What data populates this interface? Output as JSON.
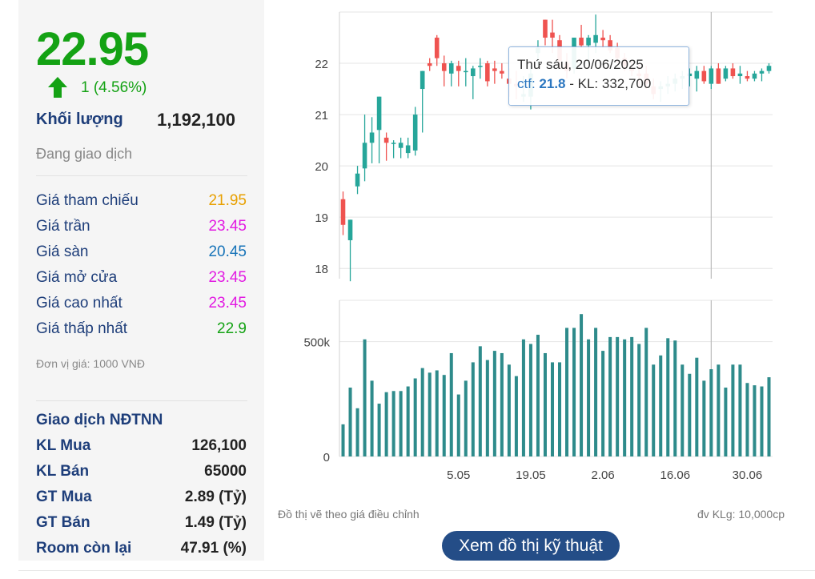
{
  "summary": {
    "price": "22.95",
    "change": "1 (4.56%)",
    "volume_label": "Khối lượng",
    "volume": "1,192,100",
    "status": "Đang giao dịch"
  },
  "price_rows": [
    {
      "label": "Giá tham chiếu",
      "value": "21.95",
      "color": "#e8a000"
    },
    {
      "label": "Giá trần",
      "value": "23.45",
      "color": "#e21be2"
    },
    {
      "label": "Giá sàn",
      "value": "20.45",
      "color": "#1673b8"
    },
    {
      "label": "Giá mở cửa",
      "value": "23.45",
      "color": "#e21be2"
    },
    {
      "label": "Giá cao nhất",
      "value": "23.45",
      "color": "#e21be2"
    },
    {
      "label": "Giá thấp nhất",
      "value": "22.9",
      "color": "#14a214"
    }
  ],
  "unit_note": "Đơn vị giá: 1000 VNĐ",
  "foreign": {
    "title": "Giao dịch NĐTNN",
    "rows": [
      {
        "label": "KL Mua",
        "value": "126,100"
      },
      {
        "label": "KL Bán",
        "value": "65000"
      },
      {
        "label": "GT Mua",
        "value": "2.89 (Tỷ)"
      },
      {
        "label": "GT Bán",
        "value": "1.49 (Tỷ)"
      },
      {
        "label": "Room còn lại",
        "value": "47.91 (%)"
      }
    ]
  },
  "colors": {
    "up": "#26a69a",
    "down": "#ef5350",
    "accent_green": "#14a214",
    "button": "#244d87"
  },
  "chart_data": {
    "type": "candlestick",
    "price_axis": {
      "ticks": [
        "18",
        "19",
        "20",
        "21",
        "22"
      ],
      "ylim": [
        17.8,
        23
      ]
    },
    "volume_axis": {
      "ticks": [
        "0",
        "500k"
      ],
      "ylim": [
        0,
        680000
      ]
    },
    "x_tick_labels": [
      "5.05",
      "19.05",
      "2.06",
      "16.06",
      "30.06"
    ],
    "x_tick_index": [
      16,
      26,
      36,
      46,
      56
    ],
    "grid": true,
    "candles": [
      {
        "o": 19.35,
        "h": 19.5,
        "l": 18.65,
        "c": 18.85,
        "v": 140000
      },
      {
        "o": 18.55,
        "h": 18.95,
        "l": 17.75,
        "c": 18.95,
        "v": 300000
      },
      {
        "o": 19.6,
        "h": 20.0,
        "l": 19.45,
        "c": 19.85,
        "v": 210000
      },
      {
        "o": 19.95,
        "h": 21.0,
        "l": 19.7,
        "c": 20.45,
        "v": 510000
      },
      {
        "o": 20.45,
        "h": 20.95,
        "l": 20.05,
        "c": 20.65,
        "v": 330000
      },
      {
        "o": 20.7,
        "h": 21.35,
        "l": 20.05,
        "c": 21.35,
        "v": 230000
      },
      {
        "o": 20.55,
        "h": 20.65,
        "l": 20.1,
        "c": 20.45,
        "v": 280000
      },
      {
        "o": 20.45,
        "h": 20.5,
        "l": 20.15,
        "c": 20.45,
        "v": 285000
      },
      {
        "o": 20.35,
        "h": 20.55,
        "l": 20.15,
        "c": 20.45,
        "v": 285000
      },
      {
        "o": 20.25,
        "h": 20.55,
        "l": 20.15,
        "c": 20.4,
        "v": 305000
      },
      {
        "o": 20.3,
        "h": 21.15,
        "l": 20.2,
        "c": 21.0,
        "v": 340000
      },
      {
        "o": 21.5,
        "h": 21.85,
        "l": 20.65,
        "c": 21.85,
        "v": 385000
      },
      {
        "o": 22.0,
        "h": 22.1,
        "l": 21.85,
        "c": 21.95,
        "v": 365000
      },
      {
        "o": 22.5,
        "h": 22.55,
        "l": 21.95,
        "c": 22.1,
        "v": 375000
      },
      {
        "o": 22.0,
        "h": 22.15,
        "l": 21.55,
        "c": 21.85,
        "v": 355000
      },
      {
        "o": 21.8,
        "h": 22.05,
        "l": 21.55,
        "c": 22.0,
        "v": 450000
      },
      {
        "o": 21.95,
        "h": 22.05,
        "l": 21.55,
        "c": 21.85,
        "v": 270000
      },
      {
        "o": 21.85,
        "h": 22.1,
        "l": 21.55,
        "c": 21.85,
        "v": 330000
      },
      {
        "o": 21.75,
        "h": 21.95,
        "l": 21.3,
        "c": 21.9,
        "v": 410000
      },
      {
        "o": 21.95,
        "h": 22.1,
        "l": 21.7,
        "c": 21.95,
        "v": 480000
      },
      {
        "o": 22.0,
        "h": 22.05,
        "l": 21.55,
        "c": 21.65,
        "v": 420000
      },
      {
        "o": 21.9,
        "h": 22.05,
        "l": 21.6,
        "c": 21.85,
        "v": 460000
      },
      {
        "o": 21.85,
        "h": 22.0,
        "l": 21.7,
        "c": 21.8,
        "v": 450000
      },
      {
        "o": 21.7,
        "h": 21.9,
        "l": 21.35,
        "c": 21.6,
        "v": 400000
      },
      {
        "o": 21.6,
        "h": 21.85,
        "l": 21.3,
        "c": 21.55,
        "v": 350000
      },
      {
        "o": 21.35,
        "h": 21.75,
        "l": 21.25,
        "c": 21.4,
        "v": 510000
      },
      {
        "o": 21.35,
        "h": 21.95,
        "l": 21.1,
        "c": 21.8,
        "v": 490000
      },
      {
        "o": 22.2,
        "h": 22.45,
        "l": 21.95,
        "c": 22.3,
        "v": 530000
      },
      {
        "o": 22.85,
        "h": 22.85,
        "l": 22.35,
        "c": 22.5,
        "v": 450000
      },
      {
        "o": 22.6,
        "h": 22.85,
        "l": 22.2,
        "c": 22.5,
        "v": 410000
      },
      {
        "o": 22.45,
        "h": 22.55,
        "l": 21.9,
        "c": 22.05,
        "v": 410000
      },
      {
        "o": 22.0,
        "h": 22.2,
        "l": 21.7,
        "c": 21.85,
        "v": 560000
      },
      {
        "o": 21.9,
        "h": 22.5,
        "l": 21.8,
        "c": 22.5,
        "v": 560000
      },
      {
        "o": 22.5,
        "h": 22.75,
        "l": 22.3,
        "c": 22.35,
        "v": 620000
      },
      {
        "o": 22.35,
        "h": 22.55,
        "l": 22.0,
        "c": 22.5,
        "v": 510000
      },
      {
        "o": 22.4,
        "h": 22.95,
        "l": 22.2,
        "c": 22.55,
        "v": 560000
      },
      {
        "o": 22.5,
        "h": 22.65,
        "l": 22.3,
        "c": 22.45,
        "v": 460000
      },
      {
        "o": 22.45,
        "h": 22.55,
        "l": 22.2,
        "c": 22.25,
        "v": 520000
      },
      {
        "o": 22.3,
        "h": 22.4,
        "l": 22.0,
        "c": 22.1,
        "v": 520000
      },
      {
        "o": 22.1,
        "h": 22.2,
        "l": 21.85,
        "c": 21.95,
        "v": 510000
      },
      {
        "o": 21.9,
        "h": 22.05,
        "l": 21.75,
        "c": 21.85,
        "v": 520000
      },
      {
        "o": 21.8,
        "h": 22.0,
        "l": 21.55,
        "c": 21.75,
        "v": 490000
      },
      {
        "o": 21.8,
        "h": 21.95,
        "l": 21.5,
        "c": 21.6,
        "v": 560000
      },
      {
        "o": 21.55,
        "h": 21.7,
        "l": 21.3,
        "c": 21.4,
        "v": 400000
      },
      {
        "o": 21.5,
        "h": 21.65,
        "l": 21.25,
        "c": 21.55,
        "v": 440000
      },
      {
        "o": 21.55,
        "h": 21.75,
        "l": 21.4,
        "c": 21.6,
        "v": 515000
      },
      {
        "o": 21.6,
        "h": 21.8,
        "l": 21.45,
        "c": 21.7,
        "v": 505000
      },
      {
        "o": 21.7,
        "h": 21.85,
        "l": 21.5,
        "c": 21.75,
        "v": 400000
      },
      {
        "o": 21.75,
        "h": 21.9,
        "l": 21.55,
        "c": 21.8,
        "v": 360000
      },
      {
        "o": 21.7,
        "h": 21.95,
        "l": 21.45,
        "c": 21.85,
        "v": 430000
      },
      {
        "o": 21.85,
        "h": 21.95,
        "l": 21.6,
        "c": 21.65,
        "v": 330000
      },
      {
        "o": 21.6,
        "h": 21.95,
        "l": 21.5,
        "c": 21.9,
        "v": 380000
      },
      {
        "o": 21.9,
        "h": 22.0,
        "l": 21.6,
        "c": 21.6,
        "v": 400000
      },
      {
        "o": 21.7,
        "h": 21.95,
        "l": 21.65,
        "c": 21.9,
        "v": 300000
      },
      {
        "o": 21.9,
        "h": 22.0,
        "l": 21.7,
        "c": 21.75,
        "v": 400000
      },
      {
        "o": 21.75,
        "h": 21.95,
        "l": 21.6,
        "c": 21.8,
        "v": 400000
      },
      {
        "o": 21.75,
        "h": 21.85,
        "l": 21.65,
        "c": 21.7,
        "v": 320000
      },
      {
        "o": 21.7,
        "h": 21.85,
        "l": 21.65,
        "c": 21.8,
        "v": 310000
      },
      {
        "o": 21.8,
        "h": 21.9,
        "l": 21.65,
        "c": 21.85,
        "v": 305000
      },
      {
        "o": 21.85,
        "h": 22.0,
        "l": 21.8,
        "c": 21.95,
        "v": 345000
      }
    ],
    "crosshair_index": 51
  },
  "tooltip": {
    "date": "Thứ sáu, 20/06/2025",
    "ctf_label": "ctf:",
    "ctf_value": "21.8",
    "kl_text": "- KL: 332,700"
  },
  "notes": {
    "adjusted": "Đồ thị vẽ theo giá điều chỉnh",
    "volume_unit": "đv KLg: 10,000cp"
  },
  "button": {
    "label": "Xem đồ thị kỹ thuật"
  }
}
